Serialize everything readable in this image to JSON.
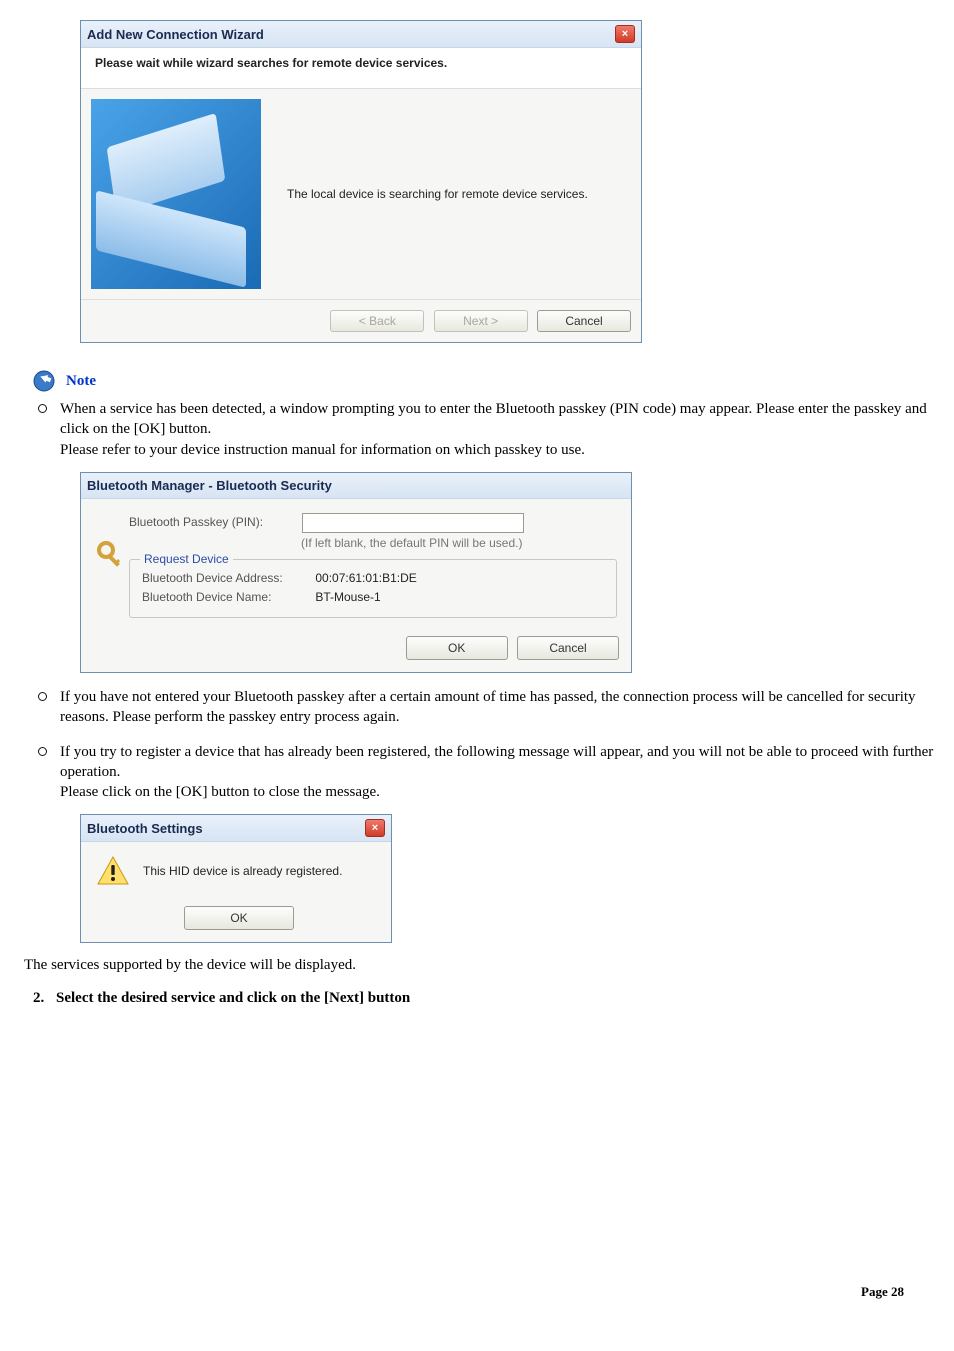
{
  "wizard": {
    "title": "Add New Connection Wizard",
    "subheader": "Please wait while wizard searches for remote device services.",
    "message": "The local device is searching for remote device services.",
    "back": "< Back",
    "next": "Next >",
    "cancel": "Cancel"
  },
  "note_label": "Note",
  "paragraphs": {
    "p1a": "When a service has been detected, a window prompting you to enter the Bluetooth passkey (PIN code) may appear. Please enter the passkey and click on the [OK] button.",
    "p1b": "Please refer to your device instruction manual for information on which passkey to use.",
    "p2": "If you have not entered your Bluetooth passkey after a certain amount of time has passed, the connection process will be cancelled for security reasons. Please perform the passkey entry process again.",
    "p3a": "If you try to register a device that has already been registered, the following message will appear, and you will not be able to proceed with further operation.",
    "p3b": "Please click on the [OK] button to close the message."
  },
  "security": {
    "title": "Bluetooth Manager - Bluetooth Security",
    "passkey_label": "Bluetooth Passkey (PIN):",
    "hint": "(If left blank, the default PIN will be used.)",
    "group_title": "Request Device",
    "addr_label": "Bluetooth Device Address:",
    "addr_value": "00:07:61:01:B1:DE",
    "name_label": "Bluetooth Device Name:",
    "name_value": "BT-Mouse-1",
    "ok": "OK",
    "cancel": "Cancel"
  },
  "settings": {
    "title": "Bluetooth Settings",
    "message": "This HID device is already registered.",
    "ok": "OK"
  },
  "services_line": "The services supported by the device will be displayed.",
  "step2": "Select the desired service and click on the [Next] button",
  "page": "Page 28"
}
